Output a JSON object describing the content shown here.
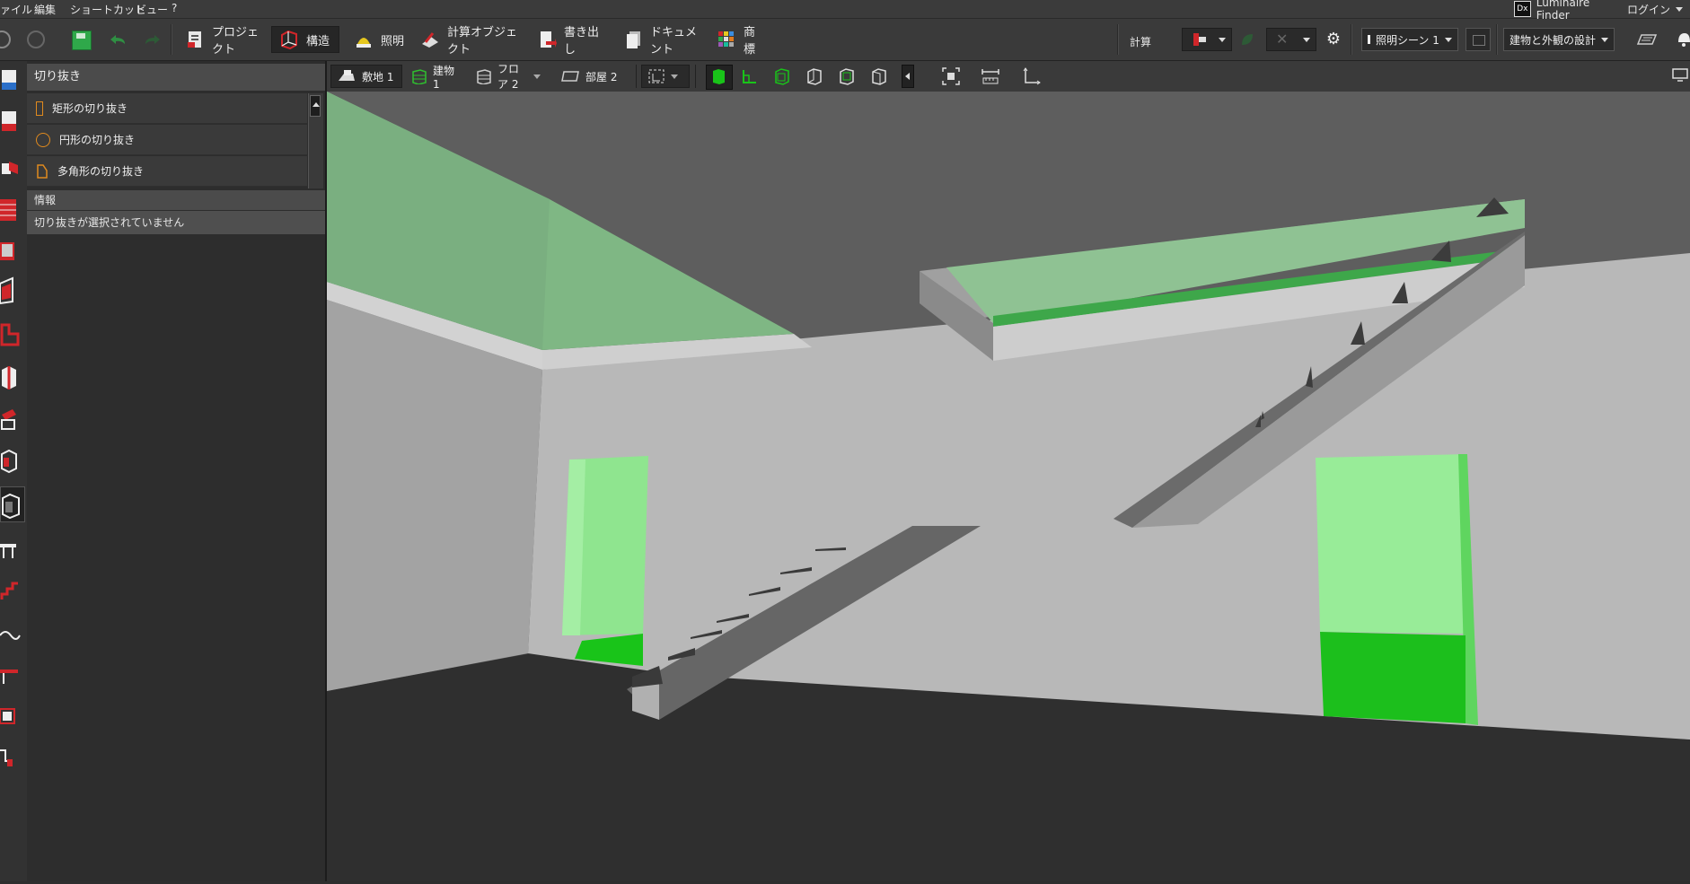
{
  "menu": [
    "ァイル",
    "編集",
    "ショートカット",
    "ビュー",
    "?"
  ],
  "topright": {
    "finder_label": "Luminaire Finder",
    "dx_badge": "Dx",
    "login_label": "ログイン"
  },
  "ribbon": {
    "tabs": [
      {
        "label": "プロジェクト",
        "active": false
      },
      {
        "label": "構造",
        "active": true
      },
      {
        "label": "照明",
        "active": false
      },
      {
        "label": "計算オブジェクト",
        "active": false
      },
      {
        "label": "書き出し",
        "active": false
      },
      {
        "label": "ドキュメント",
        "active": false
      },
      {
        "label": "商標",
        "active": false
      }
    ],
    "calc_label": "計算",
    "scene_select": "照明シーン 1",
    "design_select": "建物と外観の設計"
  },
  "panel": {
    "title": "切り抜き",
    "items": [
      {
        "label": "矩形の切り抜き",
        "icon": "rectangle-cutout-icon"
      },
      {
        "label": "円形の切り抜き",
        "icon": "circle-cutout-icon"
      },
      {
        "label": "多角形の切り抜き",
        "icon": "polygon-cutout-icon"
      }
    ],
    "info_title": "情報",
    "info_text": "切り抜きが選択されていません"
  },
  "viewport_toolbar": {
    "site": "敷地 1",
    "building": "建物 1",
    "floor": "フロア 2",
    "room": "部屋 2"
  },
  "colors": {
    "accent_red": "#d0262a",
    "green_active": "#19c419",
    "opening_green": "#8fe58f"
  }
}
